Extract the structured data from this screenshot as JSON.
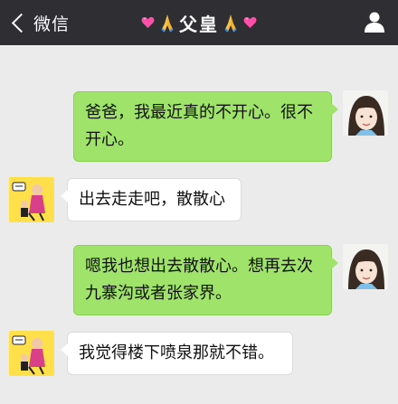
{
  "header": {
    "back_label": "微信",
    "title": "父皇",
    "colors": {
      "bar": "#2e2e33",
      "heart": "#ff4fa8",
      "pray": "#f6c24a"
    }
  },
  "messages": [
    {
      "sender": "me",
      "text": "爸爸，我最近真的不开心。很不开心。"
    },
    {
      "sender": "other",
      "text": "出去走走吧，散散心"
    },
    {
      "sender": "me",
      "text": "嗯我也想出去散散心。想再去次九寨沟或者张家界。"
    },
    {
      "sender": "other",
      "text": "我觉得楼下喷泉那就不错。"
    }
  ],
  "avatars": {
    "me": "girl-portrait",
    "other": "cartoon-scolding-child"
  },
  "colors": {
    "bubble_me": "#9fe36a",
    "bubble_other": "#ffffff",
    "background": "#ebebeb"
  }
}
